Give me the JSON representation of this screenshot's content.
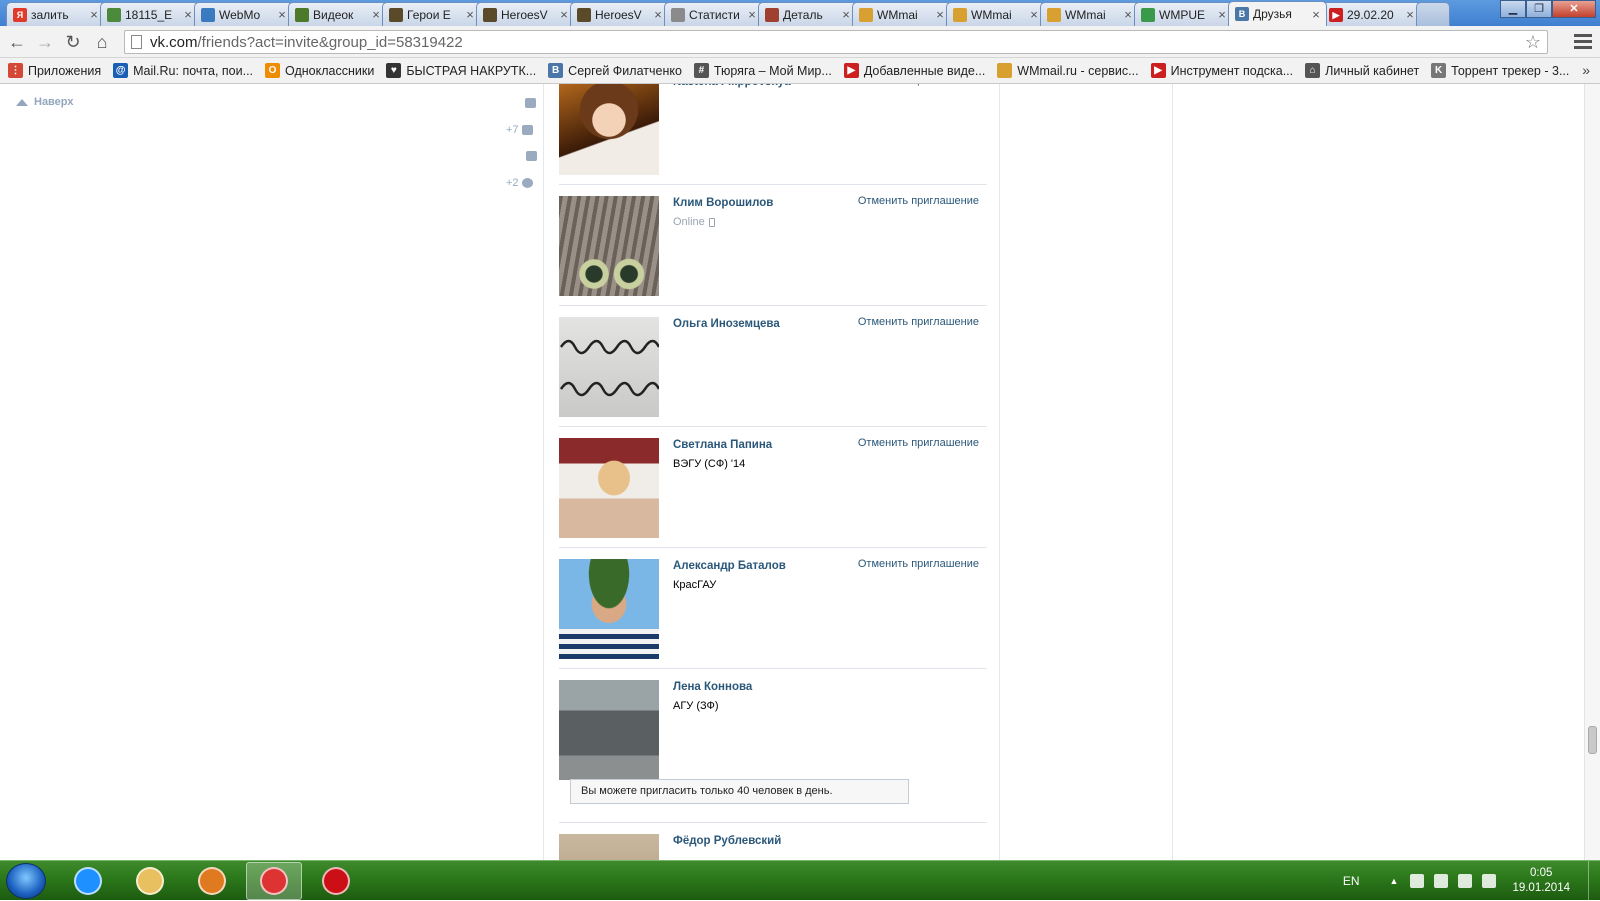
{
  "browser": {
    "tabs": [
      {
        "label": "залить",
        "favicon": "yandex-icon",
        "color": "#e03a2b",
        "glyph": "Я"
      },
      {
        "label": "18115_E",
        "favicon": "image-icon",
        "color": "#4a8a3a",
        "glyph": ""
      },
      {
        "label": "WebMo",
        "favicon": "globe-icon",
        "color": "#3a7ac0",
        "glyph": ""
      },
      {
        "label": "Видеок",
        "favicon": "film-icon",
        "color": "#4c7a2a",
        "glyph": ""
      },
      {
        "label": "Герои E",
        "favicon": "heroes-icon",
        "color": "#5a4a2a",
        "glyph": ""
      },
      {
        "label": "HeroesV",
        "favicon": "heroes-icon",
        "color": "#5a4a2a",
        "glyph": ""
      },
      {
        "label": "HeroesV",
        "favicon": "heroes-icon",
        "color": "#5a4a2a",
        "glyph": ""
      },
      {
        "label": "Статисти",
        "favicon": "shield-icon",
        "color": "#8a8a8a",
        "glyph": ""
      },
      {
        "label": "Деталь",
        "favicon": "cross-icon",
        "color": "#a04030",
        "glyph": ""
      },
      {
        "label": "WMmai",
        "favicon": "wmmail-icon",
        "color": "#d8a030",
        "glyph": ""
      },
      {
        "label": "WMmai",
        "favicon": "wmmail-icon",
        "color": "#d8a030",
        "glyph": ""
      },
      {
        "label": "WMmai",
        "favicon": "wmmail-icon",
        "color": "#d8a030",
        "glyph": ""
      },
      {
        "label": "WMPUE",
        "favicon": "wmpue-icon",
        "color": "#3a9a4a",
        "glyph": ""
      },
      {
        "label": "Друзья",
        "favicon": "vk-icon",
        "color": "#4a76a8",
        "glyph": "В",
        "active": true
      },
      {
        "label": "29.02.20",
        "favicon": "youtube-icon",
        "color": "#cc2020",
        "glyph": "▶"
      }
    ],
    "url_host": "vk.com",
    "url_path": "/friends?act=invite&group_id=58319422",
    "bookmarks": [
      {
        "label": "Приложения",
        "icon": "apps-grid-icon",
        "color": "#d34836",
        "glyph": "⋮"
      },
      {
        "label": "Mail.Ru: почта, пои...",
        "icon": "mailru-icon",
        "color": "#1a5fb4",
        "glyph": "@"
      },
      {
        "label": "Одноклассники",
        "icon": "ok-icon",
        "color": "#f08c00",
        "glyph": "O"
      },
      {
        "label": "БЫСТРАЯ НАКРУТК...",
        "icon": "heart-icon",
        "color": "#333333",
        "glyph": "♥"
      },
      {
        "label": "Сергей Филатченко",
        "icon": "vk-icon",
        "color": "#4a76a8",
        "glyph": "В"
      },
      {
        "label": "Тюряга – Мой Мир...",
        "icon": "hash-icon",
        "color": "#555555",
        "glyph": "#"
      },
      {
        "label": "Добавленные виде...",
        "icon": "youtube-icon",
        "color": "#cc2020",
        "glyph": "▶"
      },
      {
        "label": "WMmail.ru - сервис...",
        "icon": "wmmail-icon",
        "color": "#d8a030",
        "glyph": ""
      },
      {
        "label": "Инструмент подска...",
        "icon": "youtube-icon",
        "color": "#cc2020",
        "glyph": "▶"
      },
      {
        "label": "Личный кабинет",
        "icon": "gift-icon",
        "color": "#555555",
        "glyph": "⌂"
      },
      {
        "label": "Торрент трекер - 3...",
        "icon": "torrent-icon",
        "color": "#777777",
        "glyph": "K"
      }
    ]
  },
  "sidebar": {
    "up_label": "Наверх",
    "friends_count": "+7",
    "settings_count": "+2"
  },
  "friends": [
    {
      "name": "Nastena Filippovskya",
      "subtitle": "",
      "online": false,
      "cancel": "Отменить приглашение",
      "avatar": "photo-portrait-warm"
    },
    {
      "name": "Клим Ворошилов",
      "subtitle": "Online",
      "online": true,
      "cancel": "Отменить приглашение",
      "avatar": "photo-cat"
    },
    {
      "name": "Ольга Иноземцева",
      "subtitle": "",
      "online": false,
      "cancel": "Отменить приглашение",
      "avatar": "photo-handwriting"
    },
    {
      "name": "Светлана Папина",
      "subtitle": "ВЭГУ (СФ) '14",
      "online": false,
      "cancel": "Отменить приглашение",
      "avatar": "photo-girl-blonde"
    },
    {
      "name": "Александр Баталов",
      "subtitle": "КрасГАУ",
      "online": false,
      "cancel": "Отменить приглашение",
      "avatar": "photo-soldier-beret"
    },
    {
      "name": "Лена Коннова",
      "subtitle": "АГУ (ЗФ)",
      "online": false,
      "cancel": "",
      "avatar": "photo-car"
    }
  ],
  "limit_notice": "Вы можете пригласить только 40 человек в день.",
  "last_friend": {
    "name": "Фёдор Рублевский",
    "avatar": "photo-partial"
  },
  "taskbar": {
    "apps": [
      {
        "name": "internet-explorer-icon",
        "color": "#1e90ff"
      },
      {
        "name": "file-explorer-icon",
        "color": "#e8c060"
      },
      {
        "name": "media-player-icon",
        "color": "#e07a20"
      },
      {
        "name": "chrome-icon",
        "color": "#d33",
        "active": true
      },
      {
        "name": "opera-icon",
        "color": "#cc0f16"
      }
    ],
    "lang": "EN",
    "time": "0:05",
    "date": "19.01.2014"
  },
  "colors": {
    "vk_link": "#2b587a",
    "muted": "#9aa5b0",
    "taskbar_green": "#2d7a1c"
  }
}
